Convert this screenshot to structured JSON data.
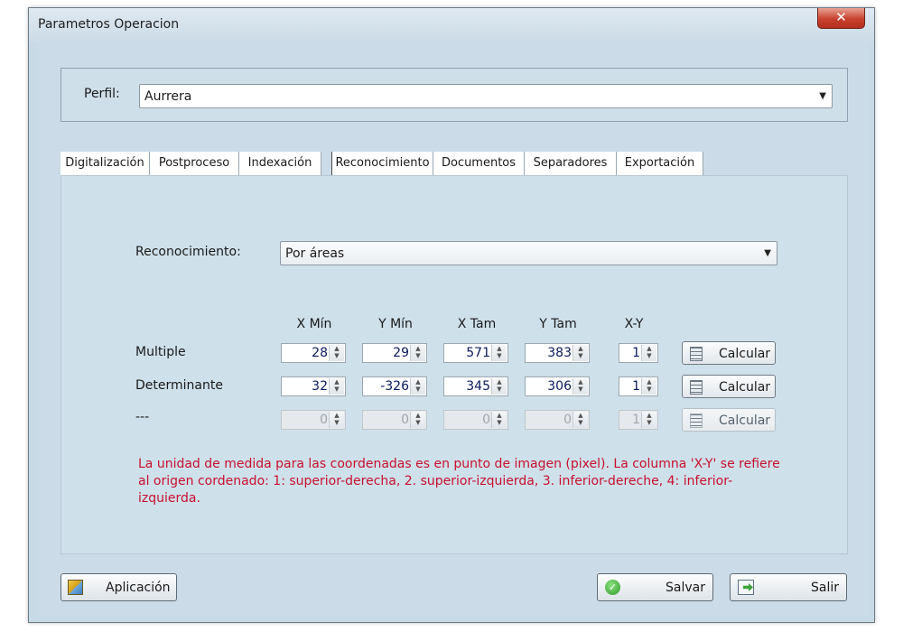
{
  "window": {
    "title": "Parametros Operacion",
    "close_label": "✕"
  },
  "profile": {
    "label": "Perfil:",
    "value": "Aurrera"
  },
  "tabs": [
    {
      "label": "Digitalización"
    },
    {
      "label": "Postproceso"
    },
    {
      "label": "Indexación"
    },
    {
      "label": "Reconocimiento"
    },
    {
      "label": "Documentos"
    },
    {
      "label": "Separadores"
    },
    {
      "label": "Exportación"
    }
  ],
  "recognition": {
    "label": "Reconocimiento:",
    "value": "Por áreas"
  },
  "columns": {
    "xmin": "X Mín",
    "ymin": "Y Mín",
    "xtam": "X Tam",
    "ytam": "Y Tam",
    "xy": "X-Y"
  },
  "rows": [
    {
      "label": "Multiple",
      "xmin": "28",
      "ymin": "29",
      "xtam": "571",
      "ytam": "383",
      "xy": "1",
      "calc": "Calcular",
      "enabled": true
    },
    {
      "label": "Determinante",
      "xmin": "32",
      "ymin": "-326",
      "xtam": "345",
      "ytam": "306",
      "xy": "1",
      "calc": "Calcular",
      "enabled": true
    },
    {
      "label": "---",
      "xmin": "0",
      "ymin": "0",
      "xtam": "0",
      "ytam": "0",
      "xy": "1",
      "calc": "Calcular",
      "enabled": false
    }
  ],
  "note": "La unidad de medida para las coordenadas es en punto de imagen (pixel). La columna 'X-Y' se refiere al origen cordenado: 1: superior-derecha, 2. superior-izquierda, 3. inferior-dereche, 4: inferior-izquierda.",
  "buttons": {
    "application": "Aplicación",
    "save": "Salvar",
    "exit": "Salir"
  },
  "icons": {
    "close": "close-icon",
    "dropdown": "chevron-down-icon",
    "spin": "spinner-arrows-icon",
    "calculator": "calculator-icon",
    "application": "application-settings-icon",
    "save": "check-circle-icon",
    "exit": "exit-door-icon"
  },
  "colors": {
    "note_text": "#c8102e",
    "window_bg": "#cbdce8",
    "close_button": "#c8412e",
    "spin_value": "#0c1a5e"
  }
}
